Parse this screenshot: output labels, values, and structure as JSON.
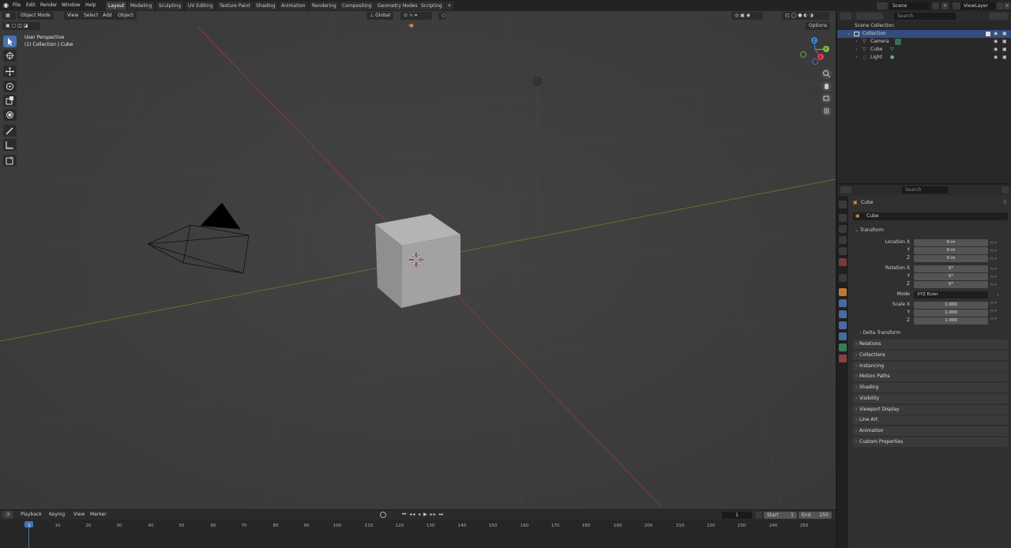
{
  "menu": [
    "File",
    "Edit",
    "Render",
    "Window",
    "Help"
  ],
  "workspaces": [
    "Layout",
    "Modeling",
    "Sculpting",
    "UV Editing",
    "Texture Paint",
    "Shading",
    "Animation",
    "Rendering",
    "Compositing",
    "Geometry Nodes",
    "Scripting"
  ],
  "active_workspace": "Layout",
  "add_tab": "+",
  "scene": {
    "name": "Scene",
    "view_layer": "ViewLayer"
  },
  "viewport": {
    "mode": "Object Mode",
    "menus": [
      "View",
      "Select",
      "Add",
      "Object"
    ],
    "orientation": "Global",
    "options": "Options",
    "info_line1": "User Perspective",
    "info_line2": "(1) Collection | Cube",
    "gizmo": {
      "x": "X",
      "y": "Y",
      "z": "Z"
    }
  },
  "outliner": {
    "search_placeholder": "Search",
    "root": "Scene Collection",
    "collection": "Collection",
    "items": [
      "Camera",
      "Cube",
      "Light"
    ]
  },
  "properties": {
    "search_placeholder": "Search",
    "object_name": "Cube",
    "object_field": "Cube",
    "transform_title": "Transform",
    "location_label": "Location X",
    "rotation_label": "Rotation X",
    "scale_label": "Scale X",
    "y_label": "Y",
    "z_label": "Z",
    "location": [
      "0 m",
      "0 m",
      "0 m"
    ],
    "rotation": [
      "0°",
      "0°",
      "0°"
    ],
    "mode_label": "Mode",
    "mode_value": "XYZ Euler",
    "scale": [
      "1.000",
      "1.000",
      "1.000"
    ],
    "delta_transform": "Delta Transform",
    "panels": [
      "Relations",
      "Collections",
      "Instancing",
      "Motion Paths",
      "Shading",
      "Visibility",
      "Viewport Display",
      "Line Art",
      "Animation",
      "Custom Properties"
    ]
  },
  "timeline": {
    "menus": [
      "Playback",
      "Keying",
      "View",
      "Marker"
    ],
    "current_frame": "1",
    "start_label": "Start",
    "start": "1",
    "end_label": "End",
    "end": "250",
    "ticks": [
      "1",
      "10",
      "20",
      "30",
      "40",
      "50",
      "60",
      "70",
      "80",
      "90",
      "100",
      "110",
      "120",
      "130",
      "140",
      "150",
      "160",
      "170",
      "180",
      "190",
      "200",
      "210",
      "220",
      "230",
      "240",
      "250"
    ]
  },
  "colors": {
    "accent": "#4772b3",
    "x_axis": "#8b3a3a",
    "y_axis": "#6b7a2a",
    "gizmo_x": "#e04050",
    "gizmo_y": "#80c040",
    "gizmo_z": "#3a8ad8"
  }
}
